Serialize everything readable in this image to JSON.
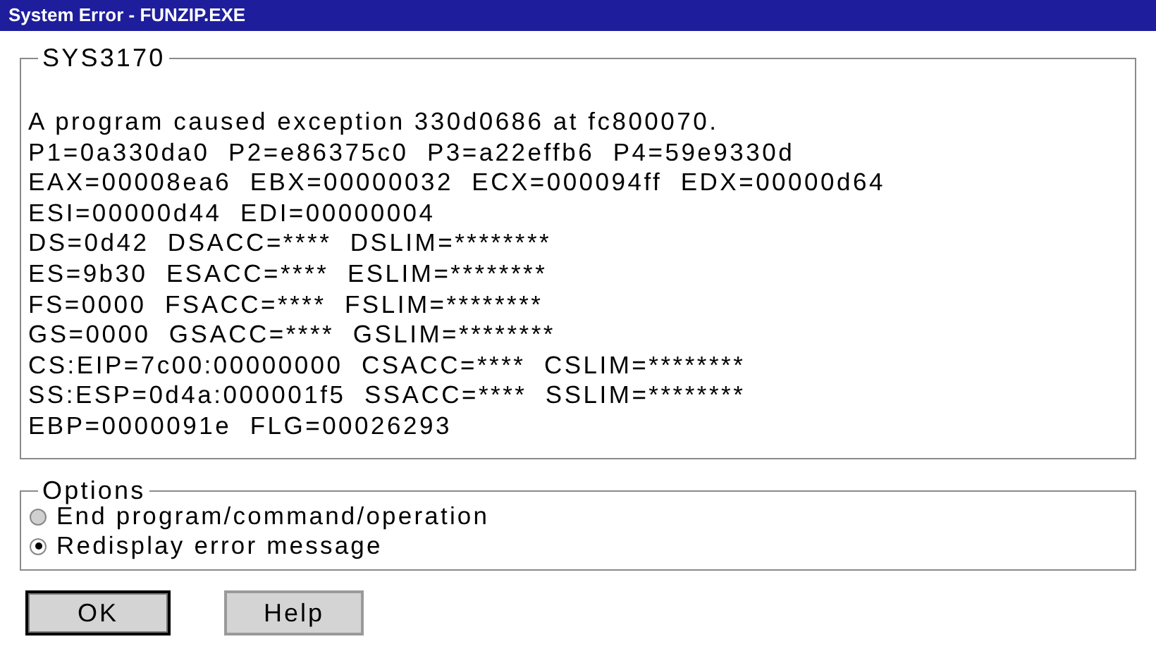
{
  "window": {
    "title": "System Error - FUNZIP.EXE"
  },
  "message_group": {
    "title": "SYS3170",
    "lines": [
      "A program caused exception 330d0686 at fc800070.",
      "P1=0a330da0  P2=e86375c0  P3=a22effb6  P4=59e9330d",
      "EAX=00008ea6  EBX=00000032  ECX=000094ff  EDX=00000d64",
      "ESI=00000d44  EDI=00000004",
      "DS=0d42  DSACC=****  DSLIM=********",
      "ES=9b30  ESACC=****  ESLIM=********",
      "FS=0000  FSACC=****  FSLIM=********",
      "GS=0000  GSACC=****  GSLIM=********",
      "CS:EIP=7c00:00000000  CSACC=****  CSLIM=********",
      "SS:ESP=0d4a:000001f5  SSACC=****  SSLIM=********",
      "EBP=0000091e  FLG=00026293"
    ]
  },
  "options_group": {
    "title": "Options",
    "options": [
      {
        "label": "End program/command/operation",
        "selected": false
      },
      {
        "label": "Redisplay error message",
        "selected": true
      }
    ]
  },
  "buttons": [
    {
      "label": "OK",
      "default": true
    },
    {
      "label": "Help",
      "default": false
    }
  ]
}
